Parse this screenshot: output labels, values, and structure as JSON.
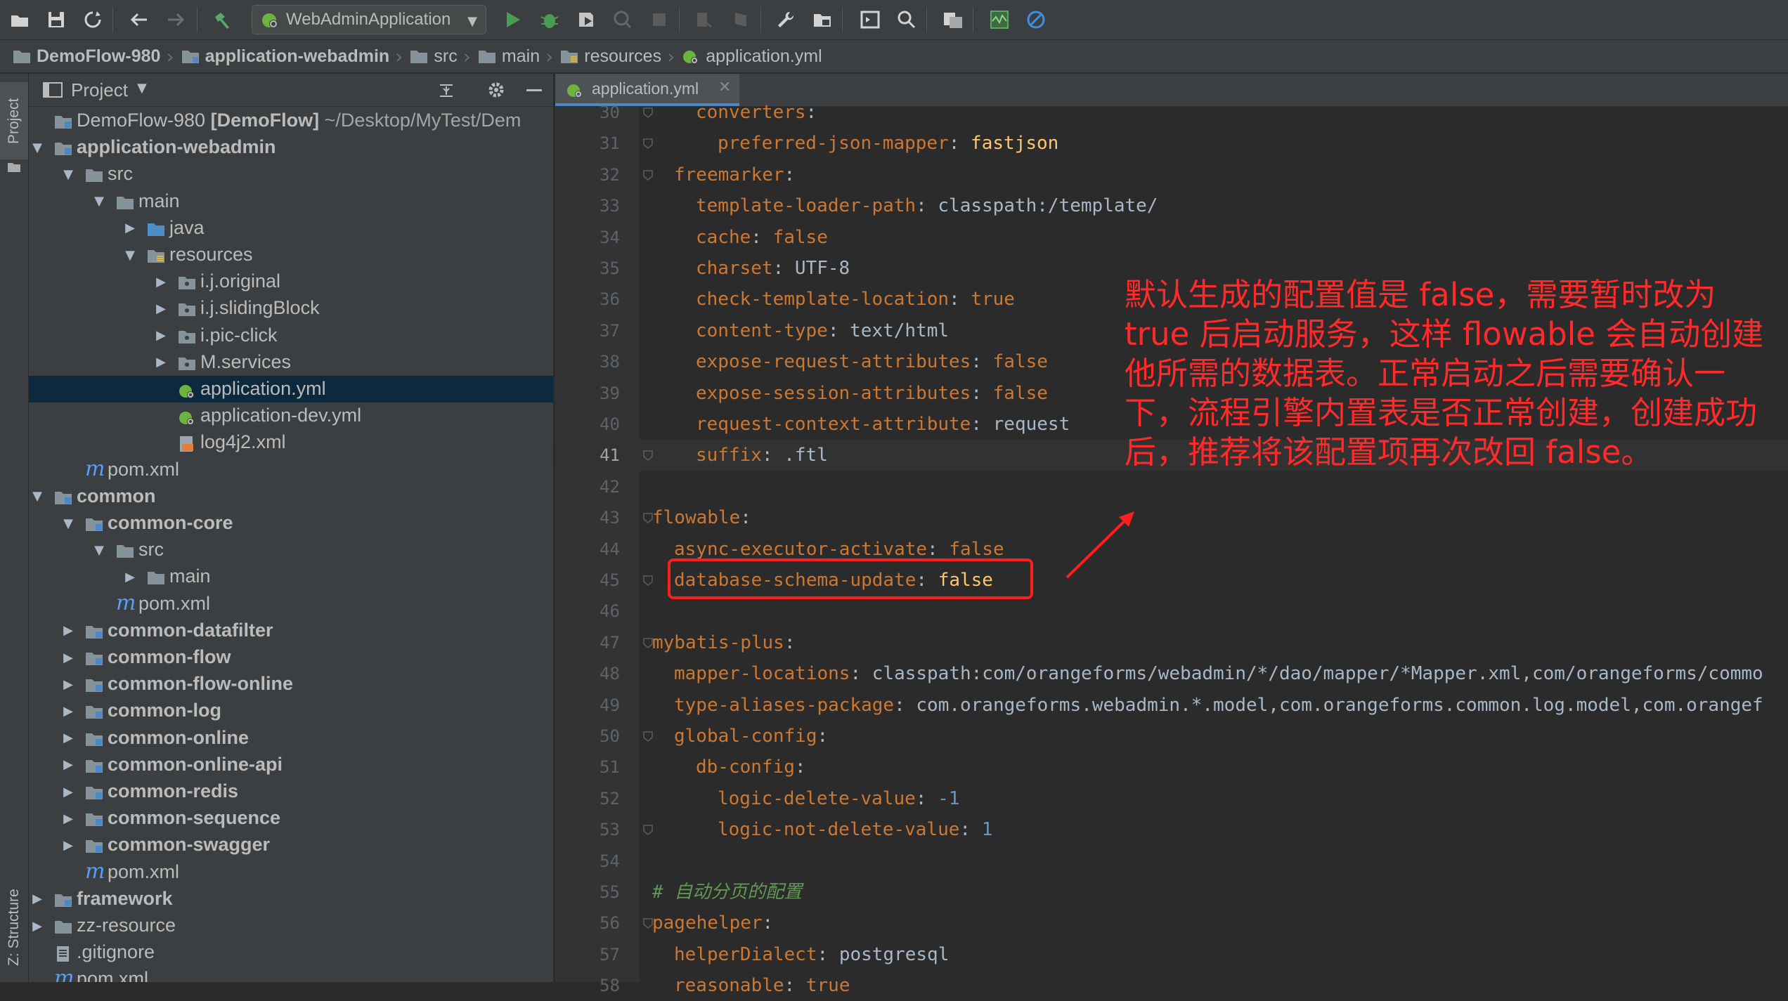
{
  "toolbar": {
    "run_config": "WebAdminApplication",
    "icons": [
      "open-folder-icon",
      "save-icon",
      "sync-icon",
      "back-icon",
      "forward-icon",
      "build-hammer-icon",
      "run-icon",
      "debug-icon",
      "coverage-icon",
      "profile-icon",
      "stop-icon",
      "attach-icon",
      "device-icon",
      "wrench-icon",
      "project-structure-icon",
      "terminal-icon",
      "search-icon",
      "vcs-icon",
      "activity-icon",
      "no-entry-icon"
    ]
  },
  "breadcrumb": [
    "DemoFlow-980",
    "application-webadmin",
    "src",
    "main",
    "resources",
    "application.yml"
  ],
  "left_stripe": {
    "project_tab": "Project",
    "structure_tab": "Z: Structure"
  },
  "project_panel": {
    "title": "Project",
    "tree": [
      {
        "label": "DemoFlow-980",
        "extra": " [DemoFlow]",
        "path": " ~/Desktop/MyTest/Dem",
        "bold": false
      },
      {
        "label": "application-webadmin",
        "bold": true
      },
      {
        "label": "src"
      },
      {
        "label": "main"
      },
      {
        "label": "java"
      },
      {
        "label": "resources"
      },
      {
        "label": "i.j.original"
      },
      {
        "label": "i.j.slidingBlock"
      },
      {
        "label": "i.pic-click"
      },
      {
        "label": "M.services"
      },
      {
        "label": "application.yml"
      },
      {
        "label": "application-dev.yml"
      },
      {
        "label": "log4j2.xml"
      },
      {
        "label": "pom.xml"
      },
      {
        "label": "common",
        "bold": true
      },
      {
        "label": "common-core",
        "bold": true
      },
      {
        "label": "src"
      },
      {
        "label": "main"
      },
      {
        "label": "pom.xml"
      },
      {
        "label": "common-datafilter",
        "bold": true
      },
      {
        "label": "common-flow",
        "bold": true
      },
      {
        "label": "common-flow-online",
        "bold": true
      },
      {
        "label": "common-log",
        "bold": true
      },
      {
        "label": "common-online",
        "bold": true
      },
      {
        "label": "common-online-api",
        "bold": true
      },
      {
        "label": "common-redis",
        "bold": true
      },
      {
        "label": "common-sequence",
        "bold": true
      },
      {
        "label": "common-swagger",
        "bold": true
      },
      {
        "label": "pom.xml"
      },
      {
        "label": "framework",
        "bold": true
      },
      {
        "label": "zz-resource"
      },
      {
        "label": ".gitignore"
      },
      {
        "label": "pom.xml"
      }
    ]
  },
  "editor": {
    "active_tab": "application.yml",
    "lines": [
      {
        "num": "30",
        "key": "converters",
        "sep": ":",
        "val": ""
      },
      {
        "num": "31",
        "key": "preferred-json-mapper",
        "sep": ": ",
        "val": "fastjson"
      },
      {
        "num": "32",
        "key": "freemarker",
        "sep": ":",
        "val": ""
      },
      {
        "num": "33",
        "key": "template-loader-path",
        "sep": ": ",
        "val": "classpath:/template/"
      },
      {
        "num": "34",
        "key": "cache",
        "sep": ": ",
        "val": "false"
      },
      {
        "num": "35",
        "key": "charset",
        "sep": ": ",
        "val": "UTF-8"
      },
      {
        "num": "36",
        "key": "check-template-location",
        "sep": ": ",
        "val": "true"
      },
      {
        "num": "37",
        "key": "content-type",
        "sep": ": ",
        "val": "text/html"
      },
      {
        "num": "38",
        "key": "expose-request-attributes",
        "sep": ": ",
        "val": "false"
      },
      {
        "num": "39",
        "key": "expose-session-attributes",
        "sep": ": ",
        "val": "false"
      },
      {
        "num": "40",
        "key": "request-context-attribute",
        "sep": ": ",
        "val": "request"
      },
      {
        "num": "41",
        "key": "suffix",
        "sep": ": ",
        "val": ".ftl"
      },
      {
        "num": "42",
        "key": "",
        "sep": "",
        "val": ""
      },
      {
        "num": "43",
        "key": "flowable",
        "sep": ":",
        "val": ""
      },
      {
        "num": "44",
        "key": "async-executor-activate",
        "sep": ": ",
        "val": "false"
      },
      {
        "num": "45",
        "key": "database-schema-update",
        "sep": ": ",
        "val": "false"
      },
      {
        "num": "46",
        "key": "",
        "sep": "",
        "val": ""
      },
      {
        "num": "47",
        "key": "mybatis-plus",
        "sep": ":",
        "val": ""
      },
      {
        "num": "48",
        "key": "mapper-locations",
        "sep": ": ",
        "val": "classpath:com/orangeforms/webadmin/*/dao/mapper/*Mapper.xml,com/orangeforms/commo"
      },
      {
        "num": "49",
        "key": "type-aliases-package",
        "sep": ": ",
        "val": "com.orangeforms.webadmin.*.model,com.orangeforms.common.log.model,com.orangef"
      },
      {
        "num": "50",
        "key": "global-config",
        "sep": ":",
        "val": ""
      },
      {
        "num": "51",
        "key": "db-config",
        "sep": ":",
        "val": ""
      },
      {
        "num": "52",
        "key": "logic-delete-value",
        "sep": ": ",
        "val": "-1"
      },
      {
        "num": "53",
        "key": "logic-not-delete-value",
        "sep": ": ",
        "val": "1"
      },
      {
        "num": "54",
        "key": "",
        "sep": "",
        "val": ""
      },
      {
        "num": "55",
        "comment": "# 自动分页的配置"
      },
      {
        "num": "56",
        "key": "pagehelper",
        "sep": ":",
        "val": ""
      },
      {
        "num": "57",
        "key": "helperDialect",
        "sep": ": ",
        "val": "postgresql"
      },
      {
        "num": "58",
        "key": "reasonable",
        "sep": ": ",
        "val": "true"
      }
    ]
  },
  "annotation": {
    "text": "默认生成的配置值是 false，需要暂时改为 true 后启动服务，这样 flowable 会自动创建他所需的数据表。正常启动之后需要确认一下，流程引擎内置表是否正常创建，创建成功后，推荐将该配置项再次改回 false。",
    "color": "#ff2a2a"
  },
  "colors": {
    "key": "#cc7832",
    "value": "#a9b7c6",
    "highlight_value": "#ffc66d",
    "number": "#6897bb",
    "comment": "#629755",
    "selection": "#0d293e",
    "tab_underline": "#4a88c7"
  }
}
